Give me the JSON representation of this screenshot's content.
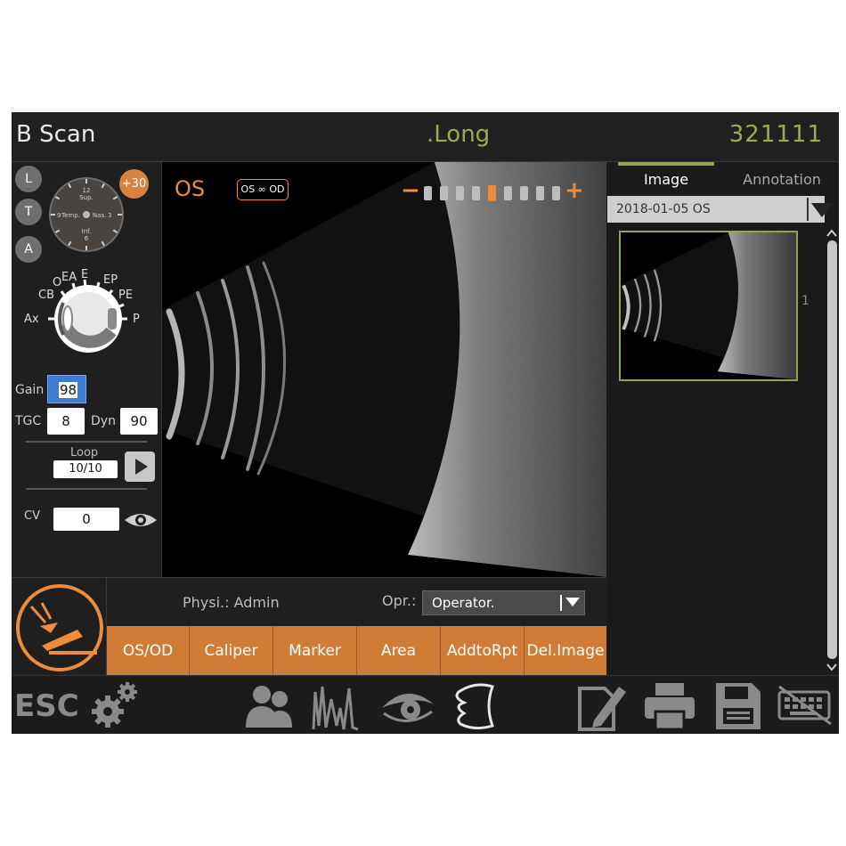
{
  "header": {
    "title": "B Scan",
    "scan_mode": ".Long",
    "patient_id": "321111"
  },
  "left_panel": {
    "plane_buttons": [
      "L",
      "T",
      "A"
    ],
    "angle_badge": "+30",
    "clock": {
      "top_hour": "12",
      "top_label": "Sup.",
      "left_hour": "9",
      "left_label": "Temp.",
      "right_label": "Nas.",
      "right_hour": "3",
      "bottom_label": "Inf.",
      "bottom_hour": "6"
    },
    "eye_labels": {
      "o": "O",
      "ea": "EA",
      "e": "E",
      "ep": "EP",
      "cb": "CB",
      "pe": "PE",
      "ax": "Ax",
      "p": "P"
    },
    "gain_label": "Gain",
    "gain_value": "98",
    "tgc_label": "TGC",
    "tgc_value": "8",
    "dyn_label": "Dyn",
    "dyn_value": "90",
    "loop_label": "Loop",
    "loop_value": "10/10",
    "cv_label": "CV",
    "cv_value": "0"
  },
  "scan": {
    "eye_label": "OS",
    "toggle_label": "OS ∞ OD",
    "minus": "−",
    "plus": "+",
    "gain_levels": 9,
    "active_level": 5
  },
  "right_panel": {
    "tabs": [
      {
        "label": "Image",
        "active": true
      },
      {
        "label": "Annotation",
        "active": false
      }
    ],
    "record": "2018-01-05 OS",
    "thumbnail_index": "1"
  },
  "bottom": {
    "physician": "Physi.: Admin",
    "operator_label": "Opr.:",
    "operator_value": "Operator.",
    "actions": [
      "OS/OD",
      "Caliper",
      "Marker",
      "Area",
      "AddtoRpt",
      "Del.Image"
    ]
  },
  "toolbar": {
    "esc_label": "ESC",
    "tools": [
      "gear-icon",
      "patients-icon",
      "a-scan-icon",
      "eye-icon",
      "probe-shape-icon",
      "edit-icon",
      "print-icon",
      "save-icon",
      "keyboard-disabled-icon"
    ]
  },
  "colors": {
    "accent_orange": "#d07c37",
    "accent_green": "#9aab54",
    "gain_highlight": "#3f7bd1"
  }
}
